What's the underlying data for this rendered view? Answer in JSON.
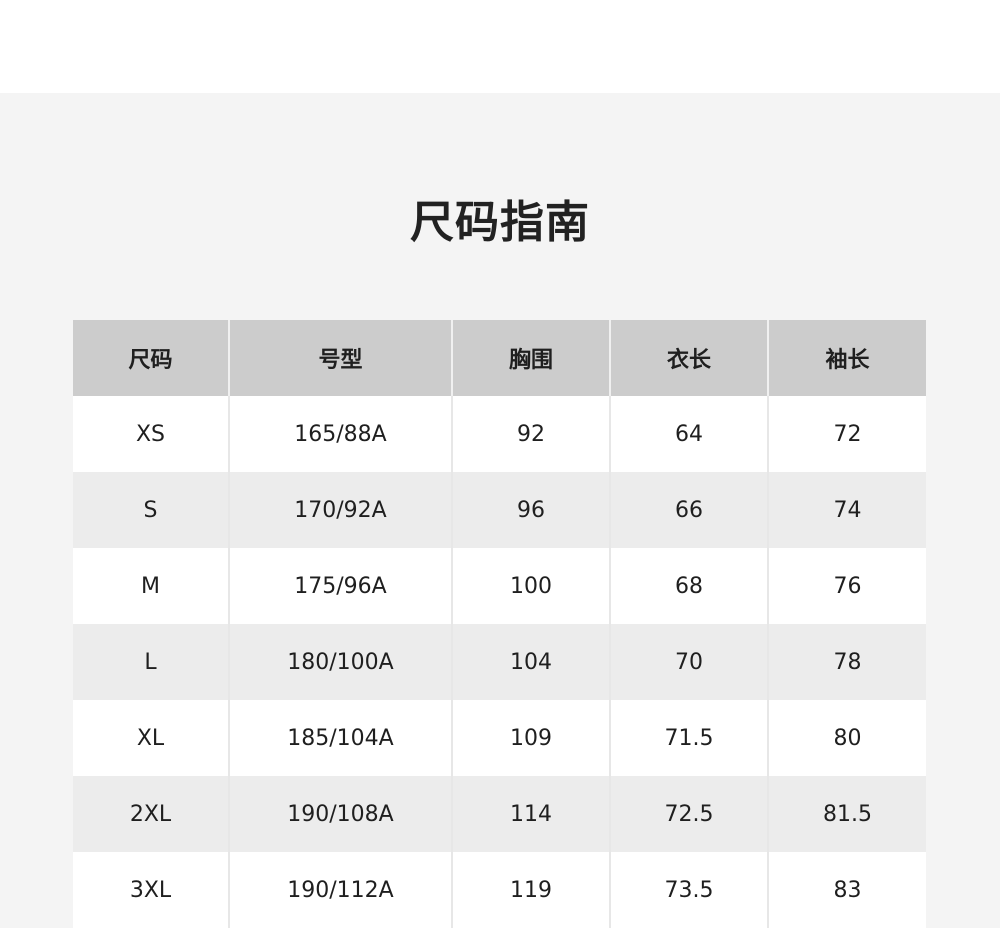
{
  "title": "尺码指南",
  "table": {
    "headers": [
      "尺码",
      "号型",
      "胸围",
      "衣长",
      "袖长"
    ],
    "rows": [
      [
        "XS",
        "165/88A",
        "92",
        "64",
        "72"
      ],
      [
        "S",
        "170/92A",
        "96",
        "66",
        "74"
      ],
      [
        "M",
        "175/96A",
        "100",
        "68",
        "76"
      ],
      [
        "L",
        "180/100A",
        "104",
        "70",
        "78"
      ],
      [
        "XL",
        "185/104A",
        "109",
        "71.5",
        "80"
      ],
      [
        "2XL",
        "190/108A",
        "114",
        "72.5",
        "81.5"
      ],
      [
        "3XL",
        "190/112A",
        "119",
        "73.5",
        "83"
      ]
    ]
  }
}
